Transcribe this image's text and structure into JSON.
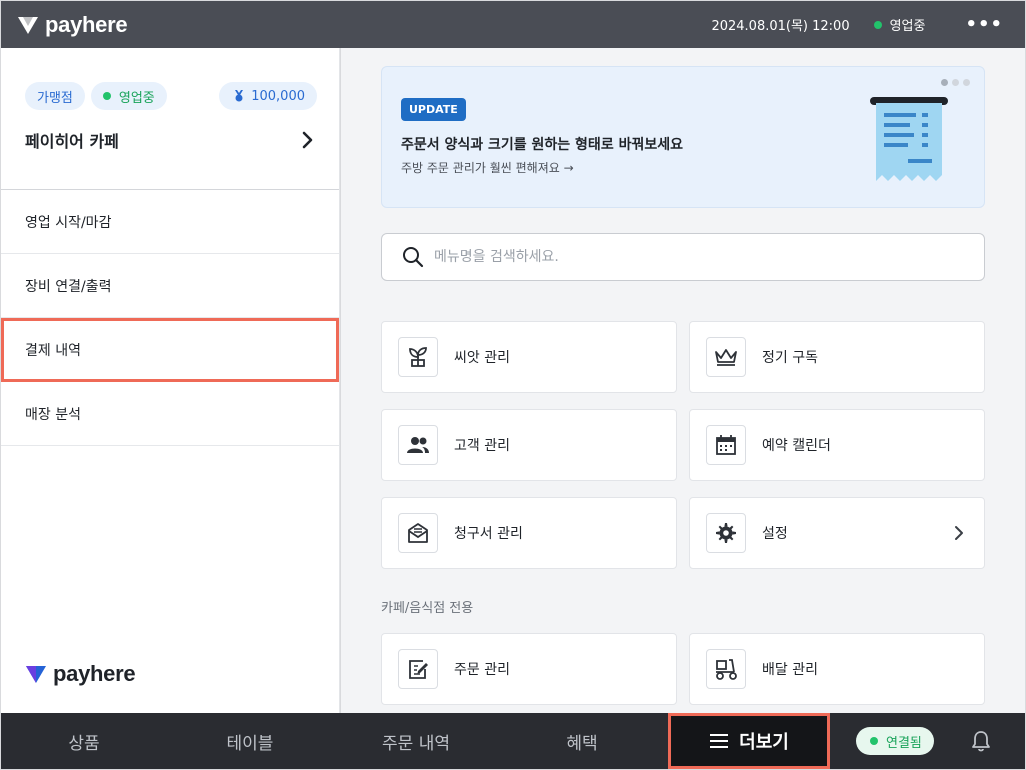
{
  "topbar": {
    "brand": "payhere",
    "datetime": "2024.08.01(목) 12:00",
    "status": "영업중",
    "more_icon": "more-horizontal-icon"
  },
  "left": {
    "badges": {
      "franchise": "가맹점",
      "open_status": "영업중",
      "points": "100,000"
    },
    "shop_name": "페이히어 카페",
    "nav_items": [
      {
        "label": "영업 시작/마감",
        "selected": false
      },
      {
        "label": "장비 연결/출력",
        "selected": false
      },
      {
        "label": "결제 내역",
        "selected": true
      },
      {
        "label": "매장 분석",
        "selected": false
      }
    ],
    "footer_brand": "payhere"
  },
  "banner": {
    "tag": "UPDATE",
    "title": "주문서 양식과 크기를 원하는 형태로 바꿔보세요",
    "subtitle": "주방 주문 관리가 훨씬 편해져요 →"
  },
  "search": {
    "placeholder": "메뉴명을 검색하세요."
  },
  "tiles": [
    {
      "label": "씨앗 관리",
      "icon": "sprout-icon"
    },
    {
      "label": "정기 구독",
      "icon": "crown-icon"
    },
    {
      "label": "고객 관리",
      "icon": "people-icon"
    },
    {
      "label": "예약 캘린더",
      "icon": "calendar-icon"
    },
    {
      "label": "청구서 관리",
      "icon": "invoice-mail-icon"
    },
    {
      "label": "설정",
      "icon": "gear-icon"
    }
  ],
  "section_label": "카페/음식점 전용",
  "cafe_tiles": [
    {
      "label": "주문 관리",
      "icon": "order-edit-icon"
    },
    {
      "label": "배달 관리",
      "icon": "scooter-icon"
    }
  ],
  "bottombar": {
    "items": [
      "상품",
      "테이블",
      "주문 내역",
      "혜택"
    ],
    "more": "더보기",
    "connection": "연결됨"
  },
  "colors": {
    "accent": "#1f6dc4",
    "highlight": "#ef6a57",
    "status_green": "#22c36b",
    "topbar": "#4a4d55",
    "bottombar": "#2a2c31"
  }
}
